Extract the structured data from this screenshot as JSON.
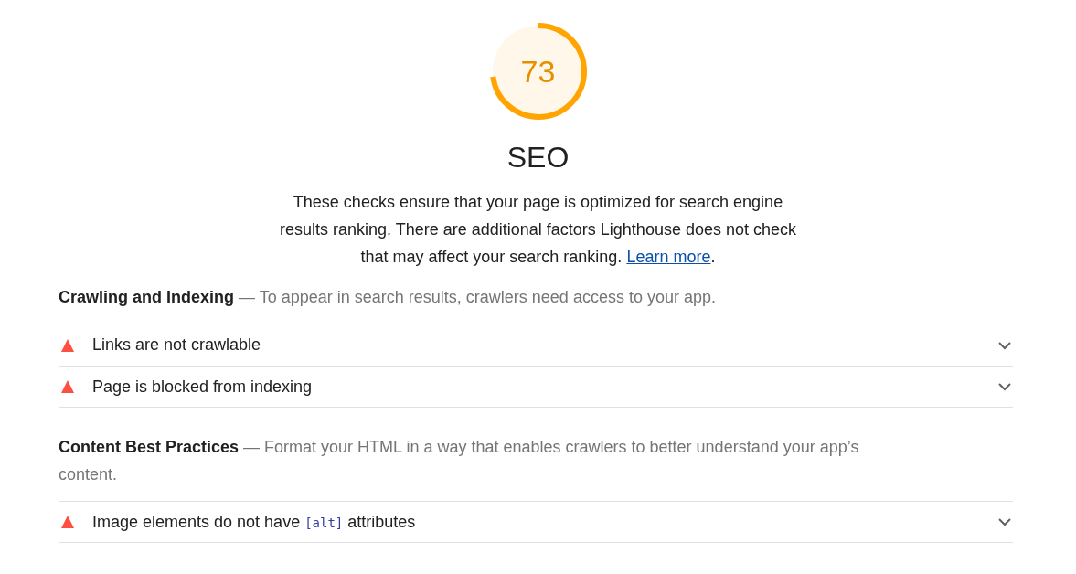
{
  "gauge": {
    "score": "73"
  },
  "category": {
    "title": "SEO",
    "description": "These checks ensure that your page is optimized for search engine results ranking. There are additional factors Lighthouse does not check that may affect your search ranking.",
    "link": "Learn more",
    "after_link": "."
  },
  "groups": [
    {
      "title": "Crawling and Indexing",
      "description": "— To appear in search results, crawlers need access to your app.",
      "audits": [
        {
          "parts": [
            {
              "kind": "text",
              "text": "Links are not crawlable"
            }
          ],
          "expanded": false
        },
        {
          "parts": [
            {
              "kind": "text",
              "text": "Page is blocked from indexing"
            }
          ],
          "expanded": false
        }
      ]
    },
    {
      "title": "Content Best Practices",
      "description": "— Format your HTML in a way that enables crawlers to better understand your app’s content.",
      "audits": [
        {
          "parts": [
            {
              "kind": "text",
              "text": "Image elements do not have "
            },
            {
              "kind": "code",
              "text": "[alt]"
            },
            {
              "kind": "text",
              "text": " attributes"
            }
          ],
          "expanded": false
        }
      ]
    }
  ]
}
